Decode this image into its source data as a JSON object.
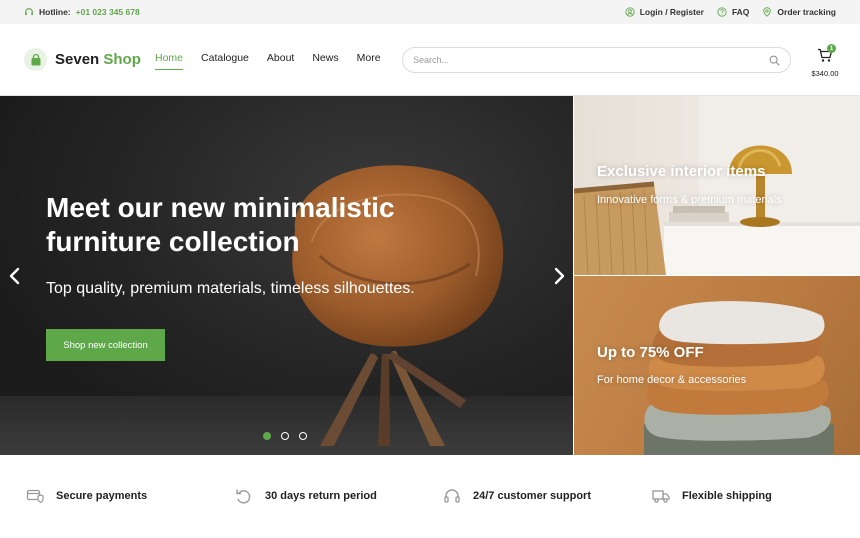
{
  "topbar": {
    "hotline_label": "Hotline:",
    "hotline_number": "+01 023 345 678",
    "links": [
      {
        "label": "Login / Register",
        "icon": "user-circle-icon"
      },
      {
        "label": "FAQ",
        "icon": "question-icon"
      },
      {
        "label": "Order tracking",
        "icon": "location-pin-icon"
      }
    ]
  },
  "header": {
    "logo_primary": "Seven",
    "logo_accent": "Shop",
    "nav": [
      {
        "label": "Home",
        "active": true
      },
      {
        "label": "Catalogue",
        "active": false
      },
      {
        "label": "About",
        "active": false
      },
      {
        "label": "News",
        "active": false
      },
      {
        "label": "More",
        "active": false
      }
    ],
    "search_placeholder": "Search...",
    "search_value": "",
    "cart_count": "1",
    "cart_total": "$340.00"
  },
  "hero": {
    "title": "Meet our new minimalistic furniture collection",
    "subtitle": "Top quality, premium materials, timeless silhouettes.",
    "button": "Shop new collection",
    "slide_count": 3,
    "active_slide": 1
  },
  "promos": [
    {
      "title": "Exclusive interior items",
      "subtitle": "Innovative forms & premium materials"
    },
    {
      "title": "Up to 75% OFF",
      "subtitle": "For home decor & accessories"
    }
  ],
  "features": [
    {
      "label": "Secure payments",
      "icon": "card-shield-icon"
    },
    {
      "label": "30 days return period",
      "icon": "return-arrow-icon"
    },
    {
      "label": "24/7 customer support",
      "icon": "headset-icon"
    },
    {
      "label": "Flexible shipping",
      "icon": "truck-icon"
    }
  ],
  "colors": {
    "accent": "#5fa84a",
    "topbar_bg": "#f4f4f4",
    "hero_bg": "#262626"
  }
}
